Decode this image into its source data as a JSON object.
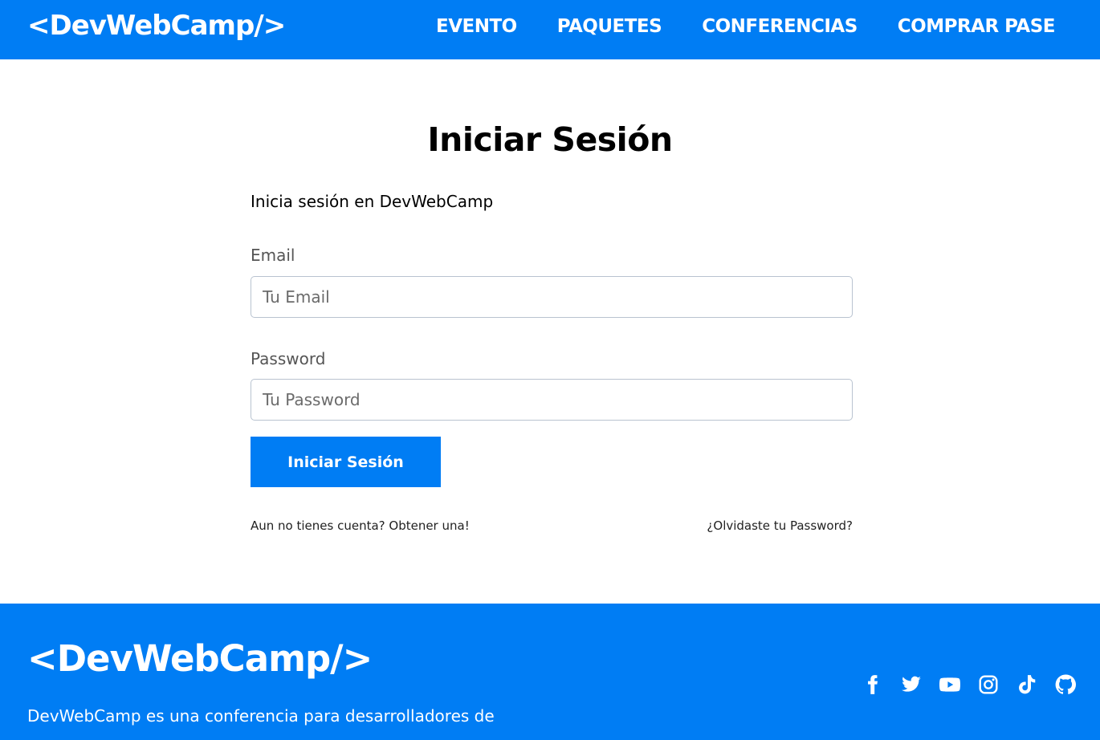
{
  "header": {
    "logo": "<DevWebCamp/>",
    "nav": [
      {
        "label": "EVENTO"
      },
      {
        "label": "PAQUETES"
      },
      {
        "label": "CONFERENCIAS"
      },
      {
        "label": "COMPRAR PASE"
      }
    ]
  },
  "login": {
    "title": "Iniciar Sesión",
    "subtitle": "Inicia sesión en DevWebCamp",
    "email_label": "Email",
    "email_placeholder": "Tu Email",
    "email_value": "",
    "password_label": "Password",
    "password_placeholder": "Tu Password",
    "password_value": "",
    "submit_label": "Iniciar Sesión",
    "register_link": "Aun no tienes cuenta? Obtener una!",
    "forgot_link": "¿Olvidaste tu Password?"
  },
  "footer": {
    "logo": "<DevWebCamp/>",
    "description": "DevWebCamp es una conferencia para desarrolladores de",
    "social": [
      "facebook-icon",
      "twitter-icon",
      "youtube-icon",
      "instagram-icon",
      "tiktok-icon",
      "github-icon"
    ]
  },
  "colors": {
    "brand_blue": "#007df4",
    "white": "#ffffff"
  }
}
